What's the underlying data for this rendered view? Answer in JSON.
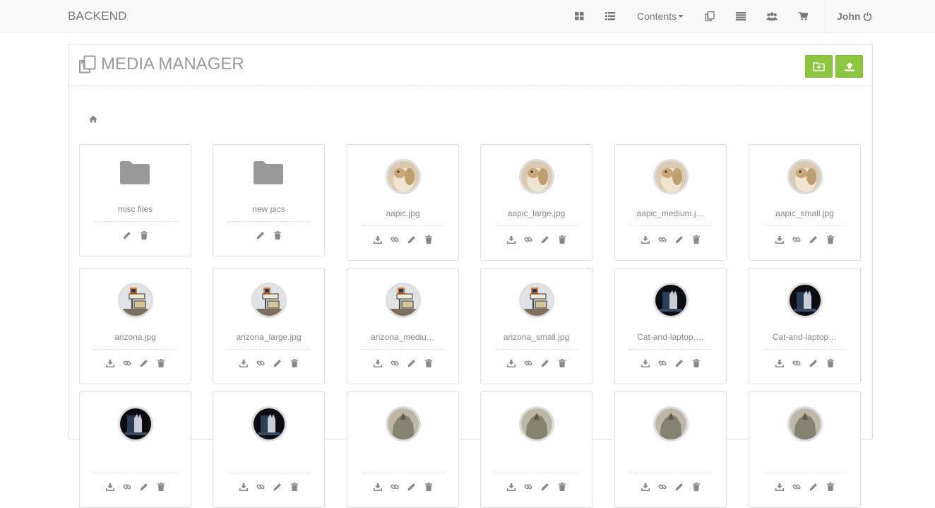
{
  "navbar": {
    "brand": "BACKEND",
    "items": [
      {
        "icon": "grid-icon"
      },
      {
        "icon": "list-icon"
      },
      {
        "label": "Contents",
        "has_caret": true
      },
      {
        "icon": "copy-files-icon"
      },
      {
        "icon": "bars-icon"
      },
      {
        "icon": "users-icon"
      },
      {
        "icon": "cart-icon"
      }
    ],
    "user": "John"
  },
  "panel": {
    "title": "MEDIA MANAGER",
    "buttons": [
      {
        "icon": "new-folder-icon"
      },
      {
        "icon": "upload-icon"
      }
    ],
    "breadcrumb_icon": "home-icon"
  },
  "items": [
    {
      "name": "misc files",
      "type": "folder"
    },
    {
      "name": "new pics",
      "type": "folder"
    },
    {
      "name": "aapic.jpg",
      "type": "image",
      "thumb": "dog"
    },
    {
      "name": "aapic_large.jpg",
      "type": "image",
      "thumb": "dog"
    },
    {
      "name": "aapic_medium.j…",
      "type": "image",
      "thumb": "dog"
    },
    {
      "name": "aapic_small.jpg",
      "type": "image",
      "thumb": "dog"
    },
    {
      "name": "arizona.jpg",
      "type": "image",
      "thumb": "motel"
    },
    {
      "name": "arizona_large.jpg",
      "type": "image",
      "thumb": "motel"
    },
    {
      "name": "arizona_mediu…",
      "type": "image",
      "thumb": "motel"
    },
    {
      "name": "arizona_small.jpg",
      "type": "image",
      "thumb": "motel"
    },
    {
      "name": "Cat-and-laptop.…",
      "type": "image",
      "thumb": "cat"
    },
    {
      "name": "Cat-and-laptop…",
      "type": "image",
      "thumb": "cat"
    },
    {
      "name": "",
      "type": "image",
      "thumb": "cat"
    },
    {
      "name": "",
      "type": "image",
      "thumb": "cat"
    },
    {
      "name": "",
      "type": "image",
      "thumb": "rhino"
    },
    {
      "name": "",
      "type": "image",
      "thumb": "rhino"
    },
    {
      "name": "",
      "type": "image",
      "thumb": "rhino"
    },
    {
      "name": "",
      "type": "image",
      "thumb": "rhino"
    }
  ],
  "colors": {
    "accent": "#8cc63f",
    "icon": "#888888",
    "nav_bg": "#f8f8f8"
  }
}
